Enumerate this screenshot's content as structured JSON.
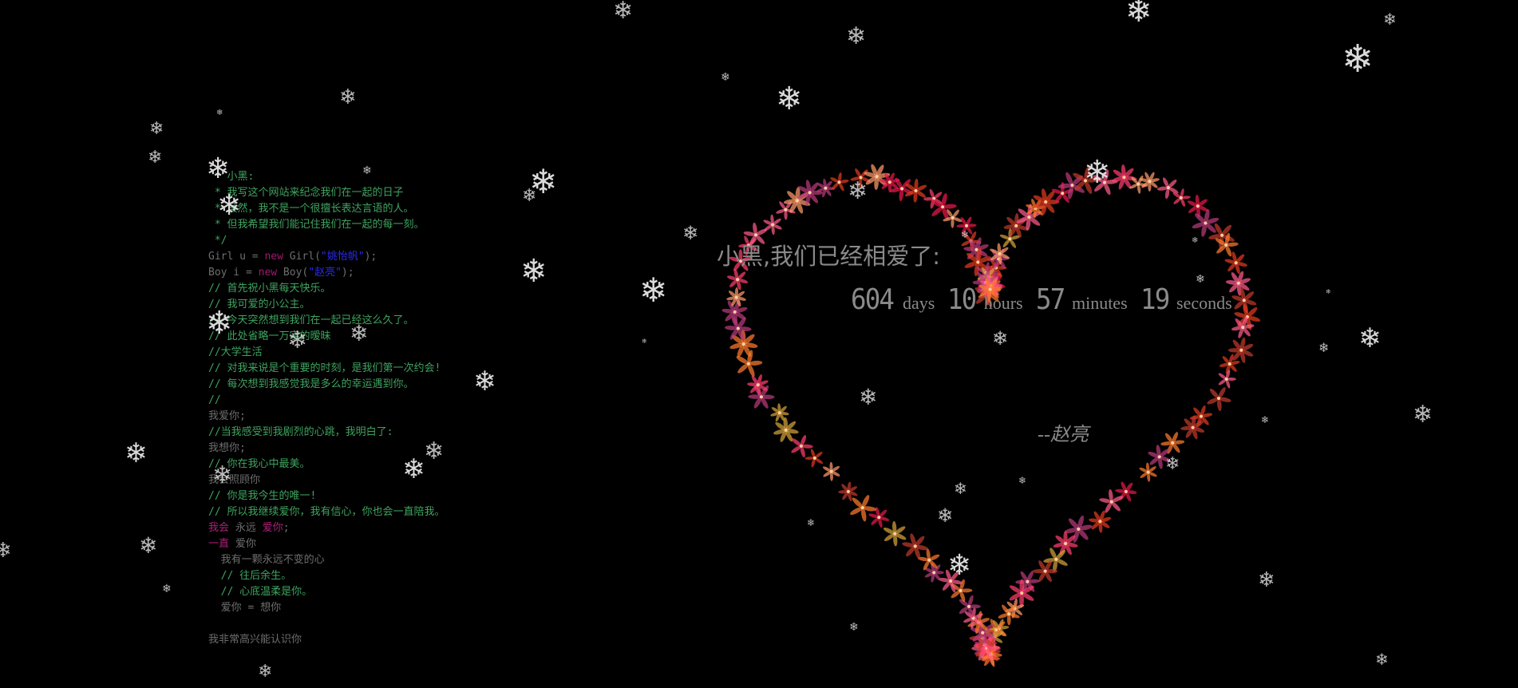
{
  "page": {
    "background": "#000000"
  },
  "code": {
    "lines": [
      [
        {
          "t": " * 小黑:",
          "c": "c-cmt"
        }
      ],
      [
        {
          "t": " * 我写这个网站来纪念我们在一起的日子",
          "c": "c-cmt"
        }
      ],
      [
        {
          "t": " * 虽然，我不是一个很擅长表达言语的人。",
          "c": "c-cmt"
        }
      ],
      [
        {
          "t": " * 但我希望我们能记住我们在一起的每一刻。",
          "c": "c-cmt"
        }
      ],
      [
        {
          "t": " */",
          "c": "c-cmt"
        }
      ],
      [
        {
          "t": "Girl u = ",
          "c": "c-plain"
        },
        {
          "t": "new",
          "c": "c-kw"
        },
        {
          "t": " Girl(",
          "c": "c-plain"
        },
        {
          "t": "\"姚怡帆\"",
          "c": "c-str"
        },
        {
          "t": ");",
          "c": "c-plain"
        }
      ],
      [
        {
          "t": "Boy i = ",
          "c": "c-plain"
        },
        {
          "t": "new",
          "c": "c-kw"
        },
        {
          "t": " Boy(",
          "c": "c-plain"
        },
        {
          "t": "\"赵亮\"",
          "c": "c-str"
        },
        {
          "t": ");",
          "c": "c-plain"
        }
      ],
      [
        {
          "t": "// 首先祝小黑每天快乐。",
          "c": "c-cmt"
        }
      ],
      [
        {
          "t": "// 我可爱的小公主。",
          "c": "c-cmt"
        }
      ],
      [
        {
          "t": "// 今天突然想到我们在一起已经这么久了。",
          "c": "c-cmt"
        }
      ],
      [
        {
          "t": "// 此处省略一万字的暧昧",
          "c": "c-cmt"
        }
      ],
      [
        {
          "t": "//大学生活",
          "c": "c-cmt"
        }
      ],
      [
        {
          "t": "// 对我来说是个重要的时刻，是我们第一次约会!",
          "c": "c-cmt"
        }
      ],
      [
        {
          "t": "// 每次想到我感觉我是多么的幸运遇到你。",
          "c": "c-cmt"
        }
      ],
      [
        {
          "t": "//",
          "c": "c-cmt"
        }
      ],
      [
        {
          "t": "我爱你;",
          "c": "c-plain"
        }
      ],
      [
        {
          "t": "//当我感受到我剧烈的心跳，我明白了:",
          "c": "c-cmt"
        }
      ],
      [
        {
          "t": "我想你;",
          "c": "c-plain"
        }
      ],
      [
        {
          "t": "// 你在我心中最美。",
          "c": "c-cmt"
        }
      ],
      [
        {
          "t": "我会照顾你",
          "c": "c-plain"
        }
      ],
      [
        {
          "t": "// 你是我今生的唯一!",
          "c": "c-cmt"
        }
      ],
      [
        {
          "t": "// 所以我继续爱你，我有信心，你也会一直陪我。",
          "c": "c-cmt"
        }
      ],
      [
        {
          "t": "我会",
          "c": "c-mag"
        },
        {
          "t": " 永远 ",
          "c": "c-plain"
        },
        {
          "t": "爱你",
          "c": "c-mag"
        },
        {
          "t": ";",
          "c": "c-plain"
        }
      ],
      [
        {
          "t": "一直",
          "c": "c-mag"
        },
        {
          "t": " 爱你",
          "c": "c-plain"
        }
      ],
      [
        {
          "t": "  我有一颗永远不变的心",
          "c": "c-plain"
        }
      ],
      [
        {
          "t": "  // 往后余生。",
          "c": "c-cmt"
        }
      ],
      [
        {
          "t": "  // 心底温柔是你。",
          "c": "c-cmt"
        }
      ],
      [
        {
          "t": "  爱你 = 想你",
          "c": "c-plain"
        }
      ],
      [
        {
          "t": "",
          "c": "c-plain"
        }
      ],
      [
        {
          "t": "我非常高兴能认识你",
          "c": "c-plain"
        }
      ]
    ]
  },
  "love": {
    "title": "小黑,我们已经相爱了:",
    "days": "604",
    "days_label": "days",
    "hours": "10",
    "hours_label": "hours",
    "minutes": "57",
    "minutes_label": "minutes",
    "seconds": "19",
    "seconds_label": "seconds",
    "signature": "--赵亮"
  },
  "colors": {
    "text_gray": "#8a8a8a",
    "comment_green": "#3fa35f",
    "keyword_magenta": "#a0186e",
    "string_blue": "#2a2aee",
    "petal_palette": [
      "#e8184a",
      "#ff3d6e",
      "#ff7a2e",
      "#c0392b",
      "#ff5a8a",
      "#d4a23a",
      "#b83a7a",
      "#ff9a6a",
      "#e03a1e"
    ]
  },
  "icons": {
    "snowflake": "snowflake-icon",
    "petal": "flower-petal-icon"
  }
}
